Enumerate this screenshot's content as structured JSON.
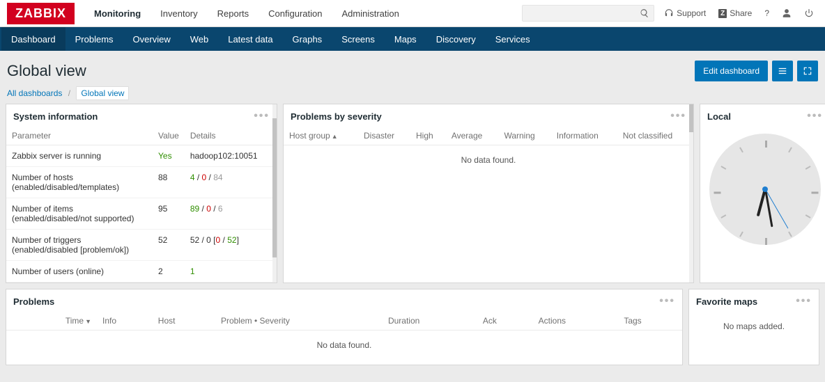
{
  "brand": "ZABBIX",
  "top_nav": {
    "items": [
      "Monitoring",
      "Inventory",
      "Reports",
      "Configuration",
      "Administration"
    ],
    "active": "Monitoring"
  },
  "top_right": {
    "support": "Support",
    "share": "Share"
  },
  "sub_nav": {
    "items": [
      "Dashboard",
      "Problems",
      "Overview",
      "Web",
      "Latest data",
      "Graphs",
      "Screens",
      "Maps",
      "Discovery",
      "Services"
    ],
    "active": "Dashboard"
  },
  "page": {
    "title": "Global view",
    "edit_btn": "Edit dashboard"
  },
  "breadcrumb": {
    "root": "All dashboards",
    "current": "Global view"
  },
  "widgets": {
    "sysinfo": {
      "title": "System information",
      "headers": [
        "Parameter",
        "Value",
        "Details"
      ],
      "rows": [
        {
          "param": "Zabbix server is running",
          "value": "Yes",
          "value_class": "tgreen",
          "details": [
            {
              "t": "hadoop102:10051"
            }
          ]
        },
        {
          "param": "Number of hosts (enabled/disabled/templates)",
          "value": "88",
          "details": [
            {
              "t": "4",
              "c": "tgreen"
            },
            {
              "t": " / "
            },
            {
              "t": "0",
              "c": "tred"
            },
            {
              "t": " / "
            },
            {
              "t": "84",
              "c": "tgrey"
            }
          ]
        },
        {
          "param": "Number of items (enabled/disabled/not supported)",
          "value": "95",
          "details": [
            {
              "t": "89",
              "c": "tgreen"
            },
            {
              "t": " / "
            },
            {
              "t": "0",
              "c": "tred"
            },
            {
              "t": " / "
            },
            {
              "t": "6",
              "c": "tgrey"
            }
          ]
        },
        {
          "param": "Number of triggers (enabled/disabled [problem/ok])",
          "value": "52",
          "details": [
            {
              "t": "52 / 0 ["
            },
            {
              "t": "0",
              "c": "tred"
            },
            {
              "t": " / "
            },
            {
              "t": "52",
              "c": "tgreen"
            },
            {
              "t": "]"
            }
          ]
        },
        {
          "param": "Number of users (online)",
          "value": "2",
          "details": [
            {
              "t": "1",
              "c": "tgreen"
            }
          ]
        }
      ]
    },
    "problems_sev": {
      "title": "Problems by severity",
      "headers": [
        "Host group",
        "Disaster",
        "High",
        "Average",
        "Warning",
        "Information",
        "Not classified"
      ],
      "nodata": "No data found."
    },
    "clock": {
      "title": "Local"
    },
    "problems": {
      "title": "Problems",
      "headers": [
        "Time",
        "Info",
        "Host",
        "Problem • Severity",
        "Duration",
        "Ack",
        "Actions",
        "Tags"
      ],
      "nodata": "No data found."
    },
    "favmaps": {
      "title": "Favorite maps",
      "nodata": "No maps added."
    }
  }
}
